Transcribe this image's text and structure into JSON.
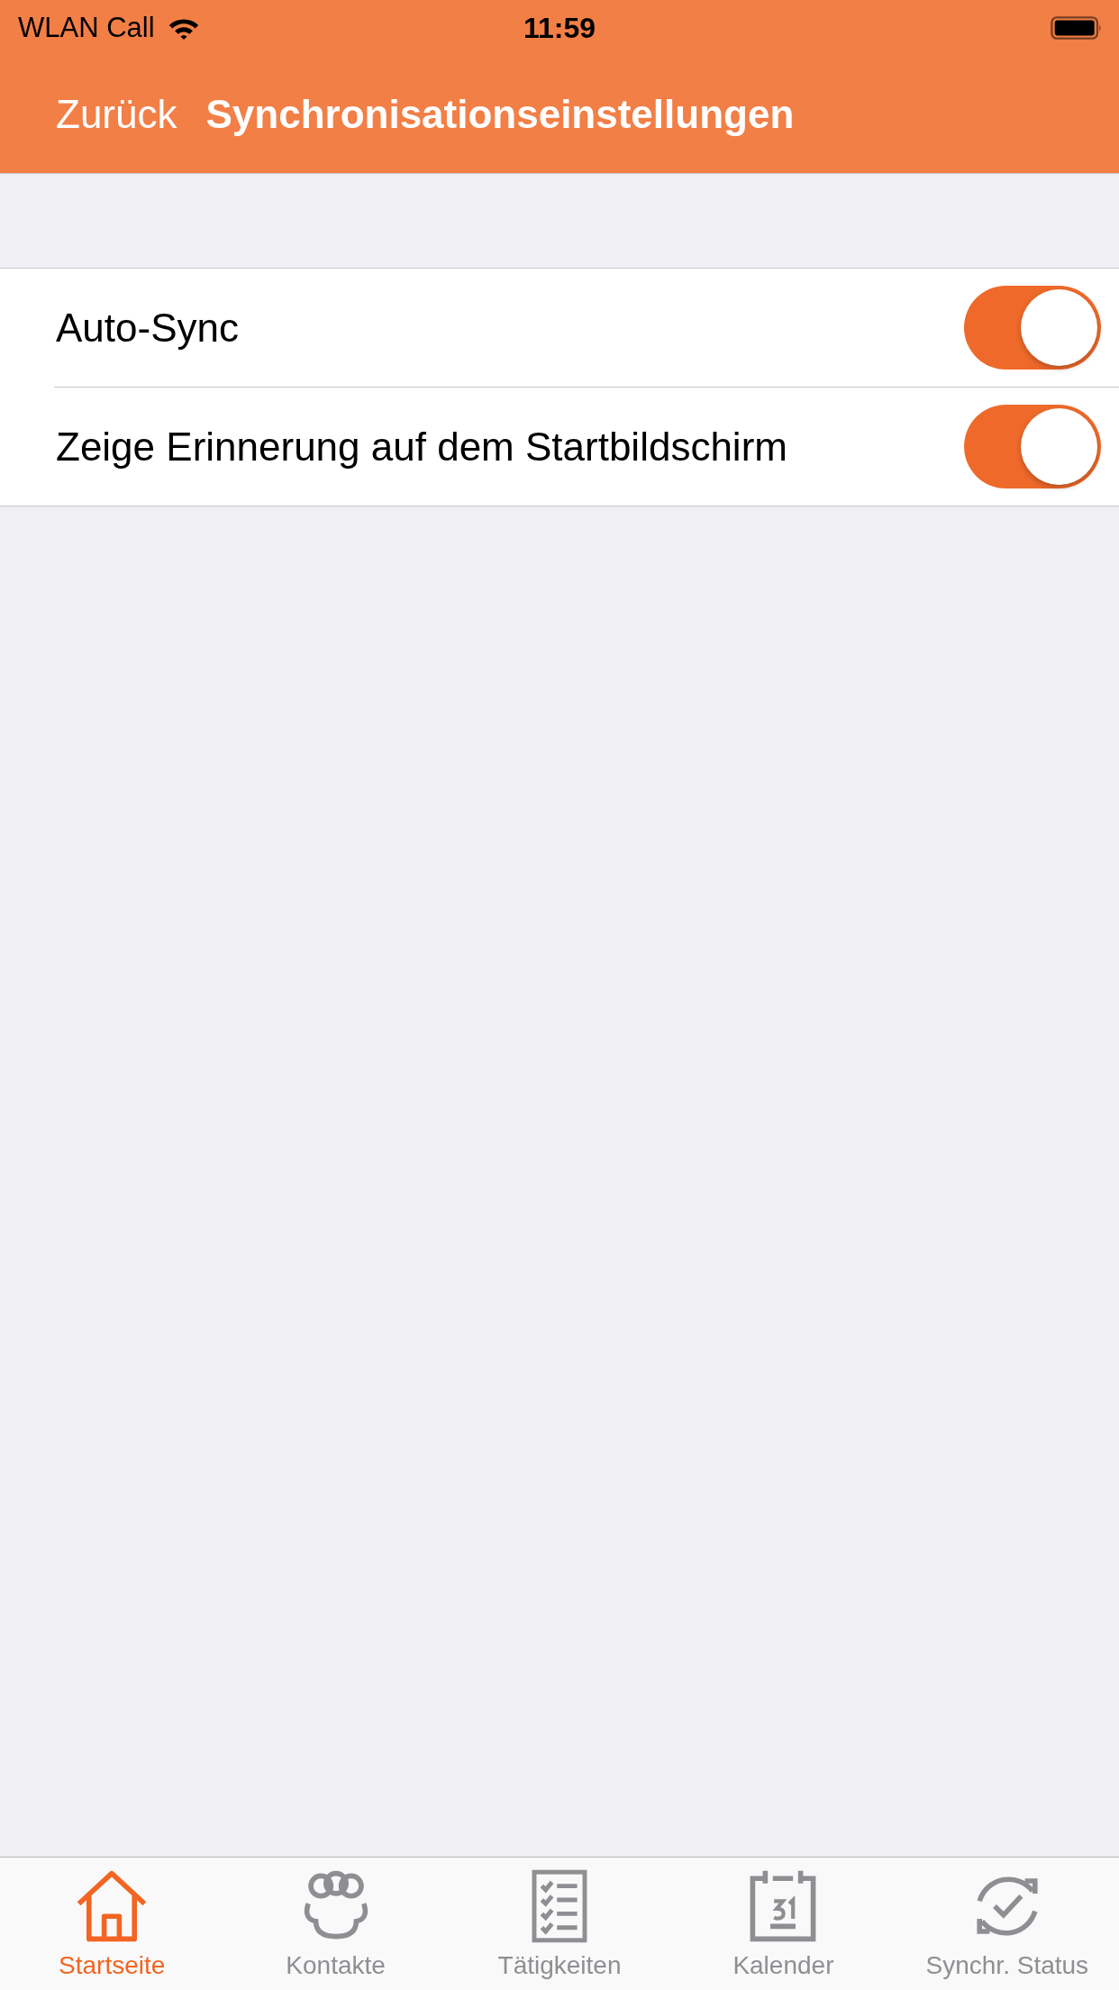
{
  "status_bar": {
    "carrier": "WLAN Call",
    "time": "11:59"
  },
  "nav_bar": {
    "back": "Zurück",
    "title": "Synchronisationseinstellungen"
  },
  "settings": [
    {
      "label": "Auto-Sync",
      "on": true
    },
    {
      "label": "Zeige Erinnerung auf dem Startbildschirm",
      "on": true
    }
  ],
  "tab_bar": [
    {
      "kind": "home",
      "label": "Startseite",
      "selected": true
    },
    {
      "kind": "contacts",
      "label": "Kontakte",
      "selected": false
    },
    {
      "kind": "tasks",
      "label": "Tätigkeiten",
      "selected": false
    },
    {
      "kind": "calendar",
      "label": "Kalender",
      "selected": false
    },
    {
      "kind": "sync",
      "label": "Synchr. Status",
      "selected": false
    }
  ]
}
